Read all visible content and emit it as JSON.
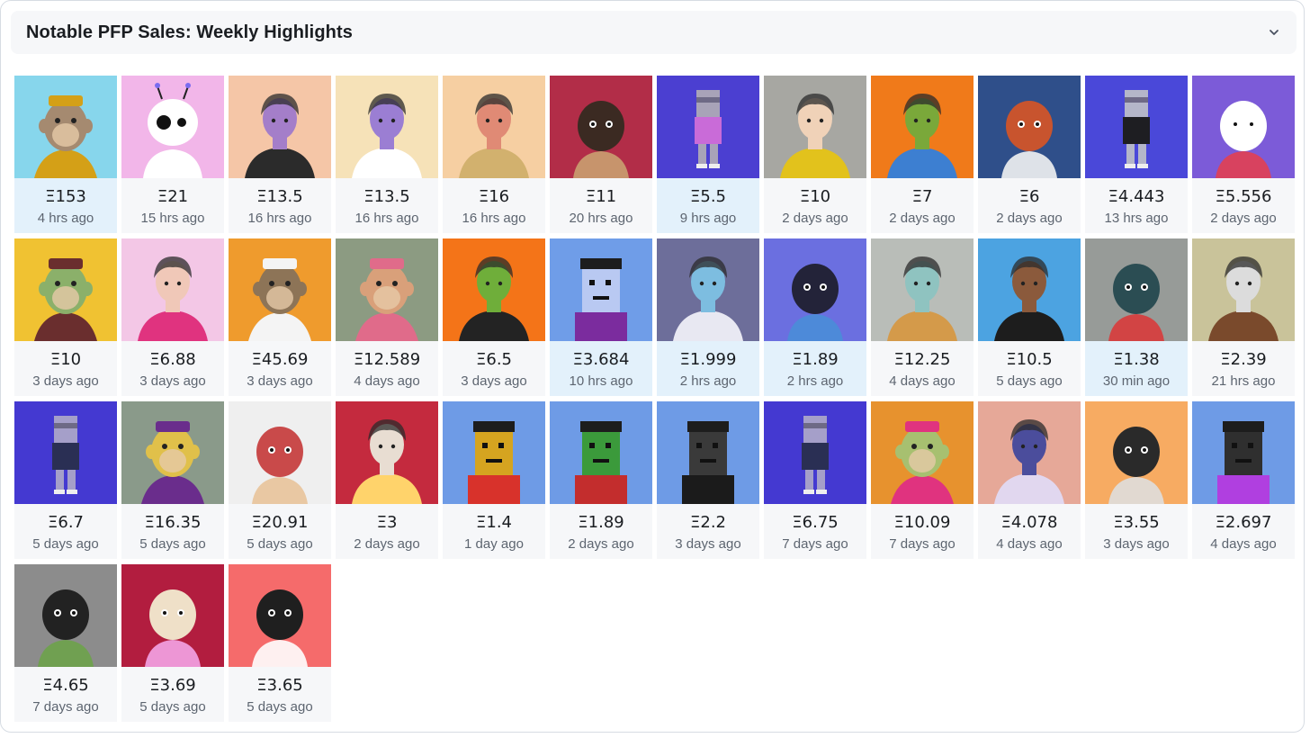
{
  "header": {
    "title": "Notable PFP Sales: Weekly Highlights",
    "toggle_icon": "chevron-down-icon"
  },
  "colors": {
    "highlight": "#e3f1fb",
    "card": "#f6f7f9"
  },
  "sales": [
    {
      "price": "Ξ153",
      "time": "4 hrs ago",
      "bg": "#87d6ec",
      "art": "ape",
      "fg": "#a58a70",
      "accent": "#d4a017",
      "hl": true
    },
    {
      "price": "Ξ21",
      "time": "15 hrs ago",
      "bg": "#f2b6e9",
      "art": "alien",
      "fg": "#ffffff",
      "accent": "#7b6cf0",
      "hl": false
    },
    {
      "price": "Ξ13.5",
      "time": "16 hrs ago",
      "bg": "#f5c6a7",
      "art": "person",
      "fg": "#a47ec9",
      "accent": "#2b2b2b",
      "hl": false
    },
    {
      "price": "Ξ13.5",
      "time": "16 hrs ago",
      "bg": "#f6e2b8",
      "art": "person",
      "fg": "#9b7ed3",
      "accent": "#ffffff",
      "hl": false
    },
    {
      "price": "Ξ16",
      "time": "16 hrs ago",
      "bg": "#f6cfa2",
      "art": "person",
      "fg": "#e08a75",
      "accent": "#d2b16e",
      "hl": false
    },
    {
      "price": "Ξ11",
      "time": "20 hrs ago",
      "bg": "#b22d48",
      "art": "blob",
      "fg": "#3b2a22",
      "accent": "#c9a070",
      "hl": false
    },
    {
      "price": "Ξ5.5",
      "time": "9 hrs ago",
      "bg": "#4b3fd1",
      "art": "voxel",
      "fg": "#a8a3b8",
      "accent": "#c96bd8",
      "hl": true
    },
    {
      "price": "Ξ10",
      "time": "2 days ago",
      "bg": "#a7a7a2",
      "art": "person",
      "fg": "#f0d2b8",
      "accent": "#e2c21c",
      "hl": false
    },
    {
      "price": "Ξ7",
      "time": "2 days ago",
      "bg": "#f07a1a",
      "art": "person",
      "fg": "#7aa83a",
      "accent": "#3d7fd1",
      "hl": false
    },
    {
      "price": "Ξ6",
      "time": "2 days ago",
      "bg": "#2f4f8a",
      "art": "blob",
      "fg": "#c8542e",
      "accent": "#f2f2f2",
      "hl": false
    },
    {
      "price": "Ξ4.443",
      "time": "13 hrs ago",
      "bg": "#4a48d9",
      "art": "voxel",
      "fg": "#b4b6c9",
      "accent": "#1e1e22",
      "hl": false
    },
    {
      "price": "Ξ5.556",
      "time": "2 days ago",
      "bg": "#7c5bd8",
      "art": "blob",
      "fg": "#ffffff",
      "accent": "#e23f52",
      "hl": false
    },
    {
      "price": "Ξ10",
      "time": "3 days ago",
      "bg": "#f0c232",
      "art": "ape",
      "fg": "#8bb06a",
      "accent": "#6a2e2e",
      "hl": false
    },
    {
      "price": "Ξ6.88",
      "time": "3 days ago",
      "bg": "#f3c7e6",
      "art": "person",
      "fg": "#f0c8b8",
      "accent": "#e0337f",
      "hl": false
    },
    {
      "price": "Ξ45.69",
      "time": "3 days ago",
      "bg": "#ef9b2d",
      "art": "ape",
      "fg": "#8d7457",
      "accent": "#f4f4f4",
      "hl": false
    },
    {
      "price": "Ξ12.589",
      "time": "4 days ago",
      "bg": "#8c9b82",
      "art": "ape",
      "fg": "#d9a07a",
      "accent": "#e06b8a",
      "hl": false
    },
    {
      "price": "Ξ6.5",
      "time": "3 days ago",
      "bg": "#f47418",
      "art": "person",
      "fg": "#6fae3a",
      "accent": "#232323",
      "hl": false
    },
    {
      "price": "Ξ3.684",
      "time": "10 hrs ago",
      "bg": "#6f9de8",
      "art": "pixel",
      "fg": "#b9c9f2",
      "accent": "#7b2c9e",
      "hl": true
    },
    {
      "price": "Ξ1.999",
      "time": "2 hrs ago",
      "bg": "#6d6e9a",
      "art": "person",
      "fg": "#7dbde0",
      "accent": "#e8e8f2",
      "hl": true
    },
    {
      "price": "Ξ1.89",
      "time": "2 hrs ago",
      "bg": "#6b6fe0",
      "art": "blob",
      "fg": "#232339",
      "accent": "#4a8dd8",
      "hl": true
    },
    {
      "price": "Ξ12.25",
      "time": "4 days ago",
      "bg": "#b9bdb8",
      "art": "person",
      "fg": "#8fc3c0",
      "accent": "#d49a4a",
      "hl": false
    },
    {
      "price": "Ξ10.5",
      "time": "5 days ago",
      "bg": "#4ca3e1",
      "art": "person",
      "fg": "#8b5a3c",
      "accent": "#1d1d1d",
      "hl": false
    },
    {
      "price": "Ξ1.38",
      "time": "30 min ago",
      "bg": "#979b98",
      "art": "blob",
      "fg": "#2b4d53",
      "accent": "#d83b3b",
      "hl": true
    },
    {
      "price": "Ξ2.39",
      "time": "21 hrs ago",
      "bg": "#c9c39a",
      "art": "person",
      "fg": "#dcdcdc",
      "accent": "#7a4a2c",
      "hl": false
    },
    {
      "price": "Ξ6.7",
      "time": "5 days ago",
      "bg": "#4439d1",
      "art": "voxel",
      "fg": "#a59fc9",
      "accent": "#2a2f54",
      "hl": false
    },
    {
      "price": "Ξ16.35",
      "time": "5 days ago",
      "bg": "#8a9a8a",
      "art": "ape",
      "fg": "#e0c04a",
      "accent": "#6a2d8c",
      "hl": false
    },
    {
      "price": "Ξ20.91",
      "time": "5 days ago",
      "bg": "#efefef",
      "art": "blob",
      "fg": "#c94a4a",
      "accent": "#e8c39a",
      "hl": false
    },
    {
      "price": "Ξ3",
      "time": "2 days ago",
      "bg": "#c42a3e",
      "art": "person",
      "fg": "#e8ddd2",
      "accent": "#ffd36b",
      "hl": false
    },
    {
      "price": "Ξ1.4",
      "time": "1 day ago",
      "bg": "#6e9be6",
      "art": "pixel",
      "fg": "#d5a420",
      "accent": "#d8322b",
      "hl": false
    },
    {
      "price": "Ξ1.89",
      "time": "2 days ago",
      "bg": "#6e9be6",
      "art": "pixel",
      "fg": "#3b9a3b",
      "accent": "#c32d2d",
      "hl": false
    },
    {
      "price": "Ξ2.2",
      "time": "3 days ago",
      "bg": "#6e9be6",
      "art": "pixel",
      "fg": "#3a3a3a",
      "accent": "#1b1b1b",
      "hl": false
    },
    {
      "price": "Ξ6.75",
      "time": "7 days ago",
      "bg": "#4439d1",
      "art": "voxel",
      "fg": "#a59fc9",
      "accent": "#2a2f54",
      "hl": false
    },
    {
      "price": "Ξ10.09",
      "time": "7 days ago",
      "bg": "#e7922e",
      "art": "ape",
      "fg": "#a7c070",
      "accent": "#e0337f",
      "hl": false
    },
    {
      "price": "Ξ4.078",
      "time": "4 days ago",
      "bg": "#e6a898",
      "art": "person",
      "fg": "#4b4d9c",
      "accent": "#e1d7ef",
      "hl": false
    },
    {
      "price": "Ξ3.55",
      "time": "3 days ago",
      "bg": "#f7ab62",
      "art": "blob",
      "fg": "#2a2a2a",
      "accent": "#dedede",
      "hl": false
    },
    {
      "price": "Ξ2.697",
      "time": "4 days ago",
      "bg": "#6e9be6",
      "art": "pixel",
      "fg": "#2f2f2f",
      "accent": "#b03fe0",
      "hl": false
    },
    {
      "price": "Ξ4.65",
      "time": "7 days ago",
      "bg": "#8c8c8c",
      "art": "blob",
      "fg": "#222222",
      "accent": "#6da24a",
      "hl": false
    },
    {
      "price": "Ξ3.69",
      "time": "5 days ago",
      "bg": "#b21d3f",
      "art": "blob",
      "fg": "#efe0c8",
      "accent": "#f3a4e6",
      "hl": false
    },
    {
      "price": "Ξ3.65",
      "time": "5 days ago",
      "bg": "#f56b6b",
      "art": "blob",
      "fg": "#1f1f1f",
      "accent": "#ffffff",
      "hl": false
    }
  ]
}
